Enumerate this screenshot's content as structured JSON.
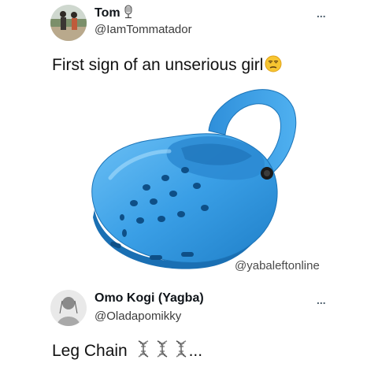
{
  "tweet1": {
    "name": "Tom",
    "handle": "@IamTommatador",
    "text": "First sign of an unserious girl",
    "more_label": "...",
    "watermark": "@yabaleftonline"
  },
  "tweet2": {
    "name": "Omo Kogi (Yagba)",
    "handle": "@Oladapomikky",
    "text": "Leg Chain",
    "ellipsis": "...",
    "more_label": "..."
  },
  "icons": {
    "tweet1_name_badge": "microphone-icon",
    "tweet1_text_emoji": "unamused-face-emoji-icon",
    "tweet2_text_emojis": [
      "dna-icon",
      "dna-icon",
      "dna-icon"
    ]
  },
  "colors": {
    "clog": "#3a9fe6",
    "clog_shadow": "#1f7fc8",
    "text": "#0f1419",
    "handle": "#3b3b3b"
  }
}
